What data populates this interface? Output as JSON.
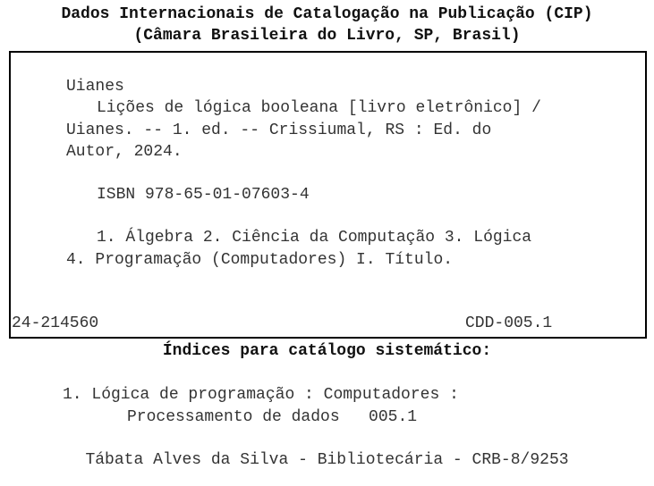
{
  "header": {
    "title": "Dados Internacionais de Catalogação na Publicação (CIP)",
    "subtitle": "(Câmara Brasileira do Livro, SP, Brasil)"
  },
  "catalog_card": {
    "author": "Uianes",
    "title_line1": "Lições de lógica booleana [livro eletrônico] /",
    "title_line2": "Uianes. -- 1. ed. -- Crissiumal, RS : Ed. do",
    "title_line3": "Autor, 2024.",
    "isbn": "ISBN 978-65-01-07603-4",
    "subjects_line1": "1. Álgebra 2. Ciência da Computação 3. Lógica",
    "subjects_line2": "4. Programação (Computadores) I. Título.",
    "record_number": "24-214560",
    "cdd": "CDD-005.1"
  },
  "index": {
    "heading": "Índices para catálogo sistemático:",
    "entry_line1": "1. Lógica de programação : Computadores :",
    "entry_line2": "Processamento de dados   005.1"
  },
  "librarian": "Tábata Alves da Silva - Bibliotecária - CRB-8/9253"
}
